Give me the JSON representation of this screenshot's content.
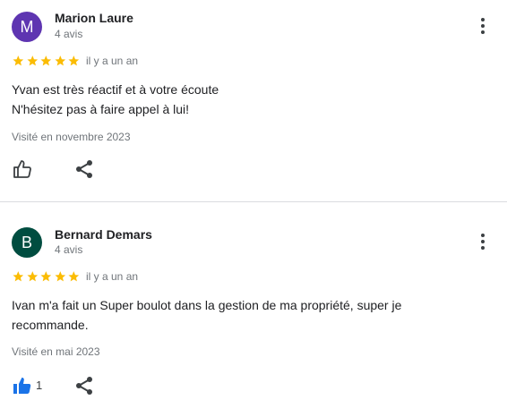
{
  "colors": {
    "star": "#fbbc04",
    "avatar_m": "#5e35b1",
    "avatar_b": "#004d40",
    "like_active": "#1a73e8"
  },
  "reviews": [
    {
      "avatar_letter": "M",
      "name": "Marion Laure",
      "review_count": "4 avis",
      "rating": 5,
      "date": "il y a un an",
      "text_lines": [
        "Yvan est très réactif et à votre écoute",
        "N'hésitez pas à faire appel à lui!"
      ],
      "visited": "Visité en novembre 2023",
      "like_count": "",
      "like_icon": "thumbs-up-outline-icon",
      "share_icon": "share-icon"
    },
    {
      "avatar_letter": "B",
      "name": "Bernard Demars",
      "review_count": "4 avis",
      "rating": 5,
      "date": "il y a un an",
      "text_lines": [
        "Ivan m'a fait un Super boulot dans la gestion de ma propriété, super je",
        "recommande."
      ],
      "visited": "Visité en mai 2023",
      "like_count": "1",
      "like_icon": "thumbs-up-filled-icon",
      "share_icon": "share-icon"
    }
  ]
}
